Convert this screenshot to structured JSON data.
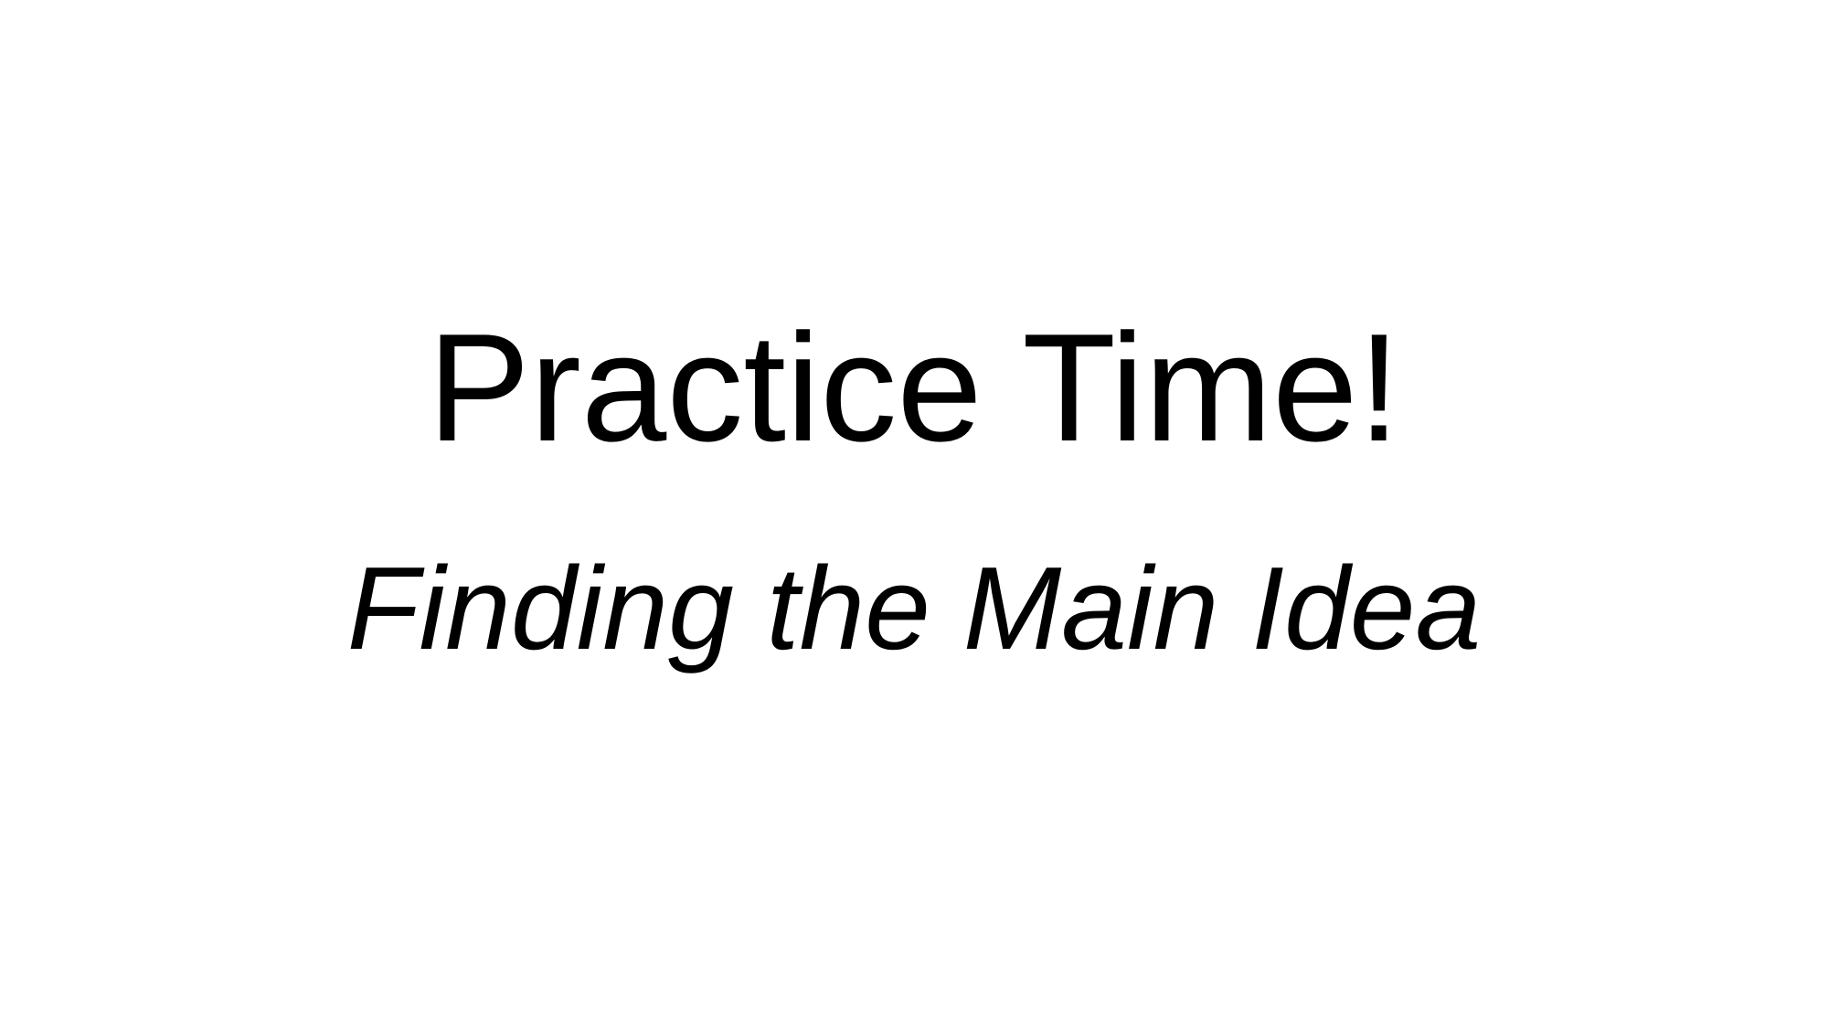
{
  "slide": {
    "title": "Practice Time!",
    "subtitle": "Finding the Main Idea"
  }
}
